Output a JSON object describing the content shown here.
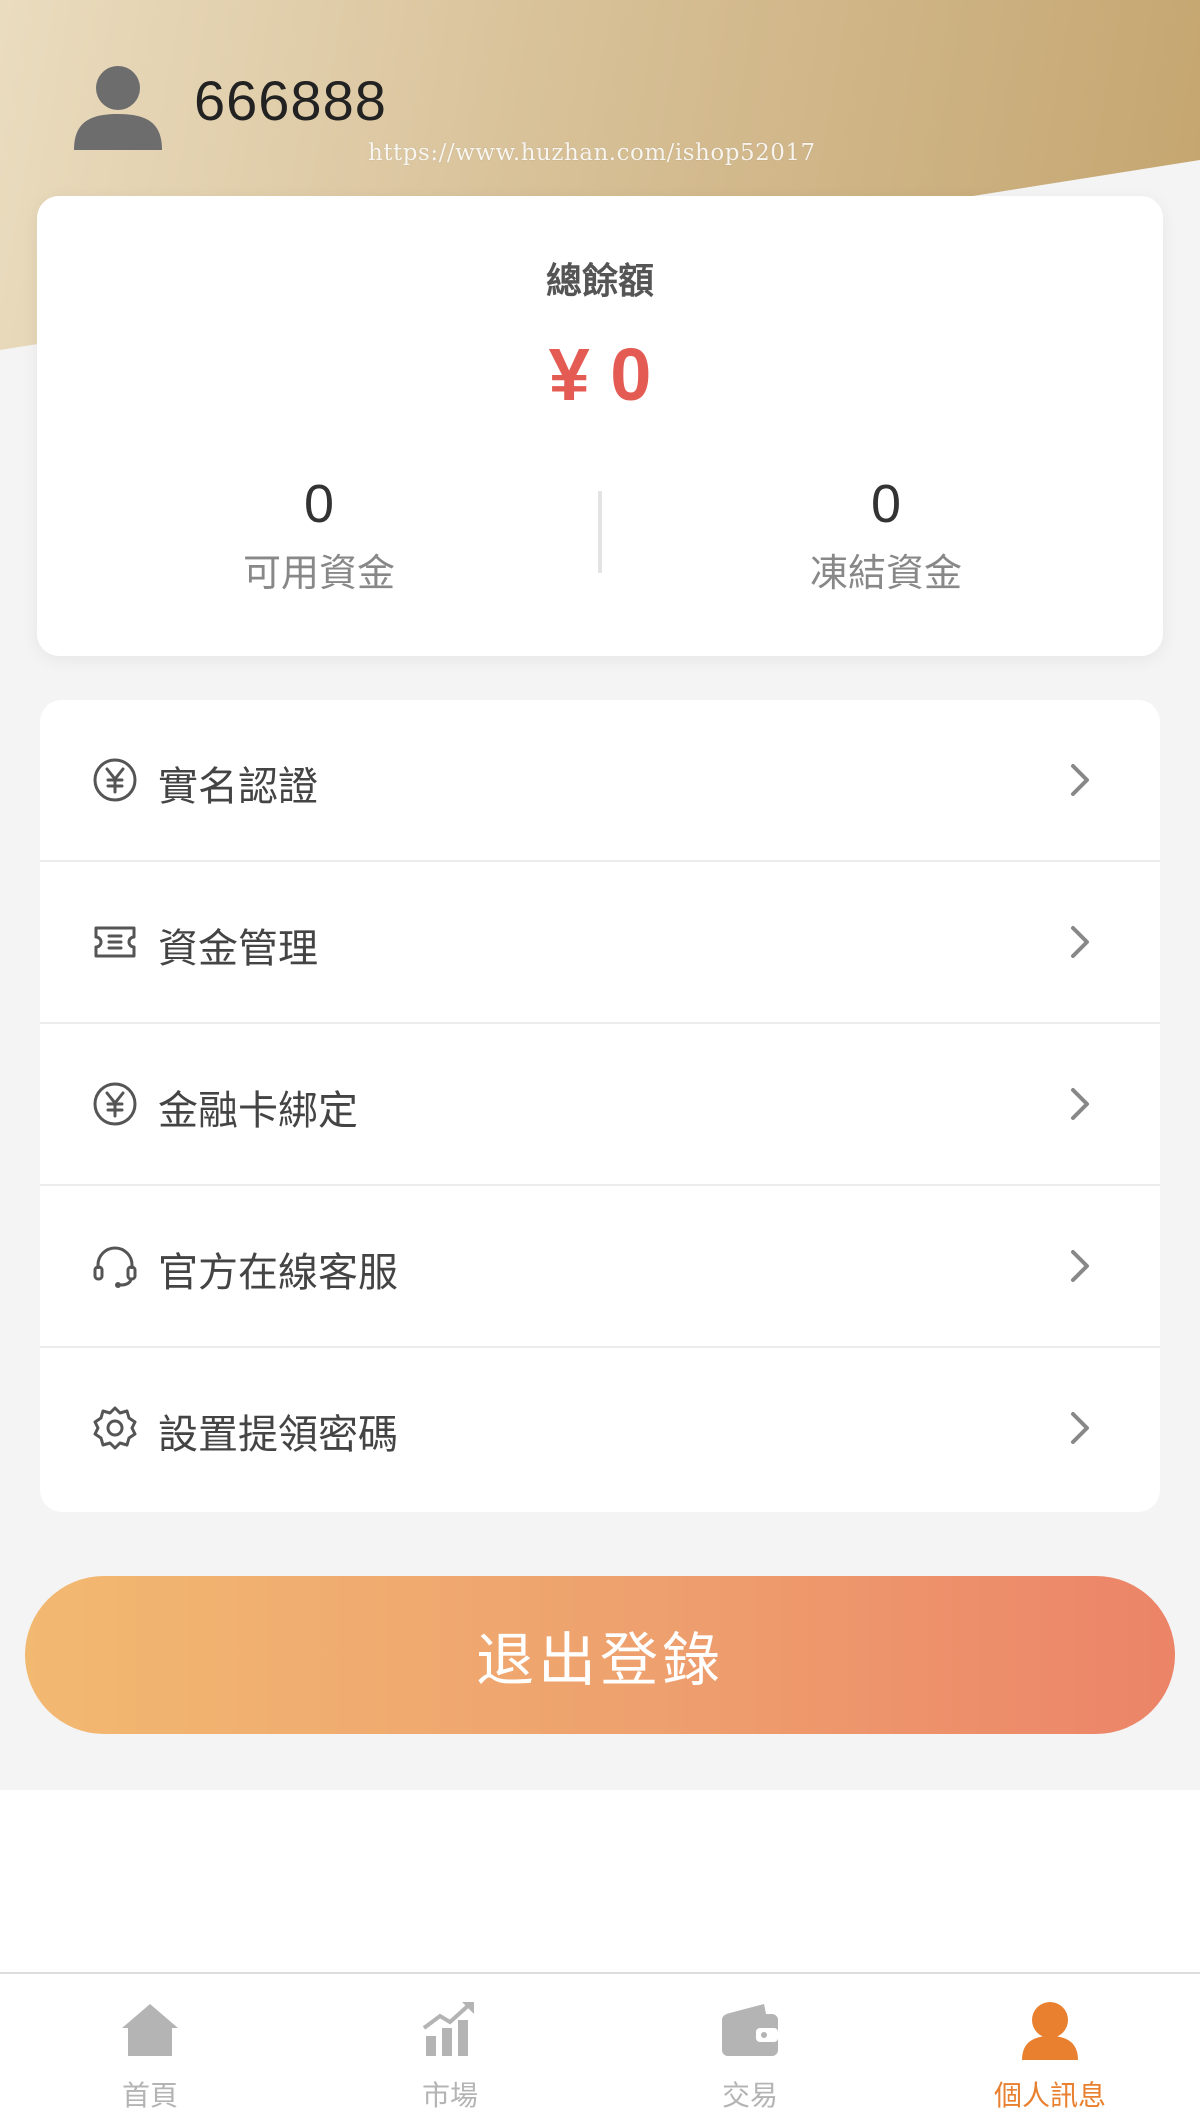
{
  "header": {
    "username": "666888",
    "watermark": "https://www.huzhan.com/ishop52017"
  },
  "balance": {
    "title": "總餘額",
    "amount": "¥ 0",
    "available": {
      "value": "0",
      "label": "可用資金"
    },
    "frozen": {
      "value": "0",
      "label": "凍結資金"
    }
  },
  "menu": {
    "items": [
      {
        "label": "實名認證",
        "icon": "yuan-circle-icon"
      },
      {
        "label": "資金管理",
        "icon": "ticket-icon"
      },
      {
        "label": "金融卡綁定",
        "icon": "yuan-circle-icon"
      },
      {
        "label": "官方在線客服",
        "icon": "headset-icon"
      },
      {
        "label": "設置提領密碼",
        "icon": "gear-icon"
      }
    ]
  },
  "logout": {
    "label": "退出登錄"
  },
  "tabbar": {
    "tabs": [
      {
        "label": "首頁",
        "icon": "home-icon"
      },
      {
        "label": "市場",
        "icon": "chart-icon"
      },
      {
        "label": "交易",
        "icon": "wallet-icon"
      },
      {
        "label": "個人訊息",
        "icon": "user-icon"
      }
    ],
    "active_index": 3
  },
  "colors": {
    "accent": "#e8802f",
    "amount": "#e45b54",
    "inactive_tab": "#b4b4b4"
  }
}
